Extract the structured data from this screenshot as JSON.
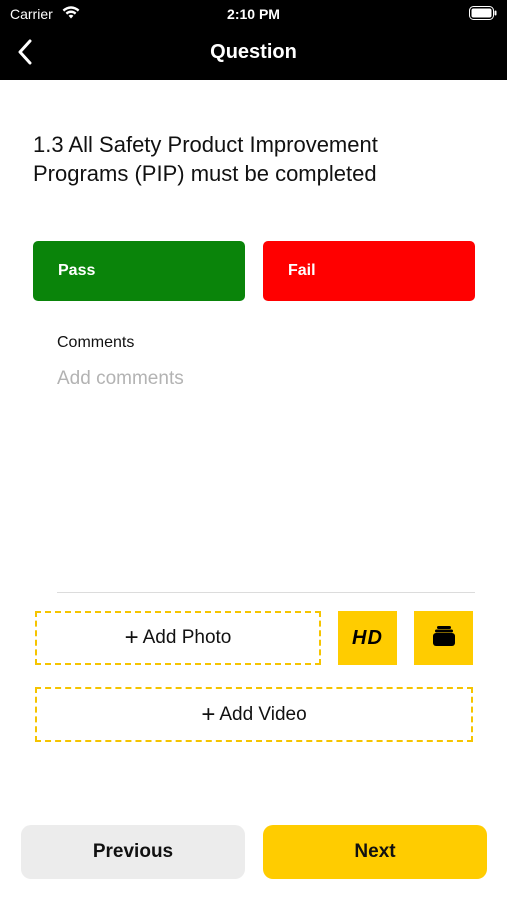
{
  "status_bar": {
    "carrier": "Carrier",
    "time": "2:10 PM",
    "icons": [
      "wifi-icon",
      "battery-icon"
    ]
  },
  "nav": {
    "title": "Question",
    "back_icon": "chevron-left-icon"
  },
  "question": {
    "title": "1.3 All Safety Product Improvement Programs (PIP) must be completed"
  },
  "result": {
    "pass_label": "Pass",
    "fail_label": "Fail"
  },
  "comments": {
    "label": "Comments",
    "placeholder": "Add comments",
    "value": ""
  },
  "media": {
    "add_photo_label": "Add Photo",
    "add_video_label": "Add Video",
    "plus_glyph": "+",
    "hd_label": "HD",
    "gallery_icon": "gallery-icon"
  },
  "footer": {
    "previous_label": "Previous",
    "next_label": "Next"
  },
  "colors": {
    "pass": "#0a840a",
    "fail": "#ff0000",
    "accent": "#ffcc00",
    "header": "#000000",
    "previous_bg": "#ececec"
  }
}
